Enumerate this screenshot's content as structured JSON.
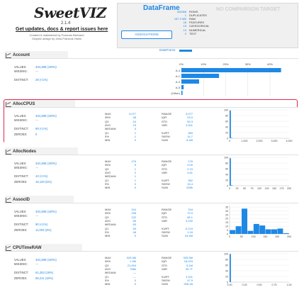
{
  "header": {
    "logo": "SweetVIZ",
    "version": "2.1.4",
    "get_help": "Get updates, docs & report issues here",
    "credit_line1": "Created & maintained by Francois Bertrand",
    "credit_line2": "Graphic design by Jean-Francois Hains"
  },
  "dataframe": {
    "title": "DataFrame",
    "no_comparison": "NO COMPARISON TARGET",
    "associations_button": "ASSOCIATIONS",
    "legend": "DataFrame",
    "rows": [
      {
        "value": "334388",
        "label": "ROWS"
      },
      {
        "value": "1",
        "label": "DUPLICATES"
      },
      {
        "value": "187.3 MB",
        "label": "RAM"
      },
      {
        "value": "28",
        "label": "FEATURES"
      },
      {
        "value": "15",
        "label": "CATEGORICAL"
      },
      {
        "value": "13",
        "label": "NUMERICAL"
      },
      {
        "value": "0",
        "label": "TEXT"
      }
    ]
  },
  "features": [
    {
      "id": "1",
      "name": "Account",
      "values": "334,388 (100%)",
      "missing": "---",
      "distinct": "28 (<1%)",
      "zeroes": "",
      "kind": "categorical",
      "chart_data": {
        "type": "bar",
        "orientation": "horizontal",
        "categories": [
          "A-4",
          "A-1",
          "A-3",
          "A-5",
          "(Other)"
        ],
        "values": [
          45,
          17,
          8,
          1,
          0.5
        ],
        "xticks": [
          "0%",
          "10%",
          "20%",
          "30%",
          "40%"
        ],
        "xlim": [
          0,
          48
        ]
      }
    },
    {
      "id": "2",
      "name": "AllocCPUS",
      "values": "334,388 (100%)",
      "missing": "---",
      "distinct": "69 (<1%)",
      "zeroes": "0",
      "kind": "numerical",
      "stats_left": [
        {
          "k": "MAX",
          "v": "3,077"
        },
        {
          "k": "95%",
          "v": "38"
        },
        {
          "k": "Q3",
          "v": "24"
        },
        {
          "k": "AVG",
          "v": "19"
        },
        {
          "k": "MEDIAN",
          "v": "3"
        },
        {
          "k": "Q1",
          "v": "1"
        },
        {
          "k": "5%",
          "v": "1"
        },
        {
          "k": "MIN",
          "v": "0"
        }
      ],
      "stats_right": [
        {
          "k": "RANGE",
          "v": "3,077"
        },
        {
          "k": "IQR",
          "v": "23.0"
        },
        {
          "k": "STD",
          "v": "59.3"
        },
        {
          "k": "VAR",
          "v": "3,511"
        },
        {
          "k": "",
          "v": ""
        },
        {
          "k": "KURT.",
          "v": "369"
        },
        {
          "k": "SKEW",
          "v": "14.7"
        },
        {
          "k": "SUM",
          "v": "6.4M"
        }
      ],
      "chart_data": {
        "type": "bar",
        "xticks": [
          "0",
          "1,000",
          "2,000",
          "3,000",
          "4,000"
        ],
        "xlim": [
          0,
          4000
        ],
        "yticks": [
          "0",
          "20",
          "40",
          "60",
          "80",
          "100"
        ],
        "ylim": [
          0,
          100
        ],
        "bins": [
          {
            "x": 0,
            "w": 100,
            "v": 98
          },
          {
            "x": 100,
            "w": 100,
            "v": 1.5
          }
        ]
      }
    },
    {
      "id": "3",
      "name": "AllocNodes",
      "values": "334,388 (100%)",
      "missing": "---",
      "distinct": "43 (<1%)",
      "zeroes": "16,120 (5%)",
      "kind": "numerical",
      "stats_left": [
        {
          "k": "MAX",
          "v": "176"
        },
        {
          "k": "95%",
          "v": "5"
        },
        {
          "k": "Q3",
          "v": "1"
        },
        {
          "k": "AVG",
          "v": "2"
        },
        {
          "k": "MEDIAN",
          "v": "1"
        },
        {
          "k": "Q1",
          "v": "1"
        },
        {
          "k": "5%",
          "v": "0"
        },
        {
          "k": "MIN",
          "v": "0"
        }
      ],
      "stats_right": [
        {
          "k": "RANGE",
          "v": "176"
        },
        {
          "k": "IQR",
          "v": "0.00"
        },
        {
          "k": "STD",
          "v": "2.15"
        },
        {
          "k": "VAR",
          "v": "4.61"
        },
        {
          "k": "",
          "v": ""
        },
        {
          "k": "KURT.",
          "v": "352"
        },
        {
          "k": "SKEW",
          "v": "15.4"
        },
        {
          "k": "SUM",
          "v": "639k"
        }
      ],
      "chart_data": {
        "type": "bar",
        "xticks": [
          "0",
          "25",
          "50",
          "75",
          "100",
          "125",
          "150",
          "175",
          "200"
        ],
        "xlim": [
          0,
          200
        ],
        "yticks": [
          "0",
          "20",
          "40",
          "60",
          "80",
          "100"
        ],
        "ylim": [
          0,
          100
        ],
        "bins": [
          {
            "x": 0,
            "w": 5,
            "v": 97
          },
          {
            "x": 5,
            "w": 5,
            "v": 2
          }
        ]
      }
    },
    {
      "id": "4",
      "name": "AssocID",
      "values": "334,388 (100%)",
      "missing": "---",
      "distinct": "90 (<1%)",
      "zeroes": "11,003 (3%)",
      "kind": "numerical",
      "stats_left": [
        {
          "k": "MAX",
          "v": "244"
        },
        {
          "k": "95%",
          "v": "196"
        },
        {
          "k": "Q3",
          "v": "132"
        },
        {
          "k": "AVG",
          "v": "89"
        },
        {
          "k": "MEDIAN",
          "v": "83"
        },
        {
          "k": "Q1",
          "v": "59"
        },
        {
          "k": "5%",
          "v": "48"
        },
        {
          "k": "MIN",
          "v": "0"
        }
      ],
      "stats_right": [
        {
          "k": "RANGE",
          "v": "244"
        },
        {
          "k": "IQR",
          "v": "72.0"
        },
        {
          "k": "STD",
          "v": "56.1"
        },
        {
          "k": "VAR",
          "v": "3,150"
        },
        {
          "k": "",
          "v": ""
        },
        {
          "k": "KURT.",
          "v": "-0.124"
        },
        {
          "k": "SKEW",
          "v": "1.16"
        },
        {
          "k": "SUM",
          "v": "44.4M"
        }
      ],
      "chart_data": {
        "type": "bar",
        "xticks": [
          "0",
          "50",
          "100",
          "150",
          "200",
          "250"
        ],
        "xlim": [
          0,
          250
        ],
        "yticks": [
          "0",
          "5",
          "10",
          "15",
          "20",
          "25",
          "30",
          "35"
        ],
        "ylim": [
          0,
          37
        ],
        "bins": [
          {
            "x": 0,
            "w": 25,
            "v": 5
          },
          {
            "x": 25,
            "w": 25,
            "v": 10
          },
          {
            "x": 50,
            "w": 25,
            "v": 33
          },
          {
            "x": 75,
            "w": 25,
            "v": 4
          },
          {
            "x": 100,
            "w": 25,
            "v": 13
          },
          {
            "x": 125,
            "w": 25,
            "v": 11
          },
          {
            "x": 150,
            "w": 25,
            "v": 6
          },
          {
            "x": 175,
            "w": 25,
            "v": 6
          },
          {
            "x": 200,
            "w": 25,
            "v": 7
          },
          {
            "x": 225,
            "w": 25,
            "v": 1
          }
        ]
      }
    },
    {
      "id": "5",
      "name": "CPUTimeRAW",
      "values": "334,388 (100%)",
      "missing": "---",
      "distinct": "61,253 (18%)",
      "zeroes": "58,211 (18%)",
      "kind": "numerical",
      "stats_left": [
        {
          "k": "MAX",
          "v": "925.9M"
        },
        {
          "k": "95%",
          "v": "1.3M"
        },
        {
          "k": "Q3",
          "v": "21,004"
        },
        {
          "k": "AVG",
          "v": "766k"
        },
        {
          "k": "MEDIAN",
          "v": "---"
        },
        {
          "k": "Q1",
          "v": "---"
        },
        {
          "k": "5%",
          "v": "0"
        },
        {
          "k": "MIN",
          "v": "0"
        }
      ],
      "stats_right": [
        {
          "k": "RANGE",
          "v": "925.9M"
        },
        {
          "k": "IQR",
          "v": "18,023"
        },
        {
          "k": "STD",
          "v": "5.1M"
        },
        {
          "k": "VAR",
          "v": "25.7T"
        },
        {
          "k": "",
          "v": ""
        },
        {
          "k": "KURT.",
          "v": "4,911"
        },
        {
          "k": "SKEW",
          "v": "47.9"
        },
        {
          "k": "SUM",
          "v": "256.1B"
        }
      ],
      "chart_data": {
        "type": "bar",
        "xticks": [
          "0.00",
          "0.25",
          "0.50",
          "0.75",
          "1.00"
        ],
        "xlim": [
          0,
          1
        ],
        "yticks": [
          "0",
          "20",
          "40",
          "60",
          "80",
          "100"
        ],
        "ylim": [
          0,
          100
        ],
        "bins": [
          {
            "x": 0,
            "w": 0.025,
            "v": 99
          }
        ]
      }
    }
  ],
  "labels": {
    "values": "VALUES:",
    "missing": "MISSING:",
    "distinct": "DISTINCT:",
    "zeroes": "ZEROES:"
  },
  "colors": {
    "accent": "#1e88e5",
    "highlight": "#e0284a"
  }
}
